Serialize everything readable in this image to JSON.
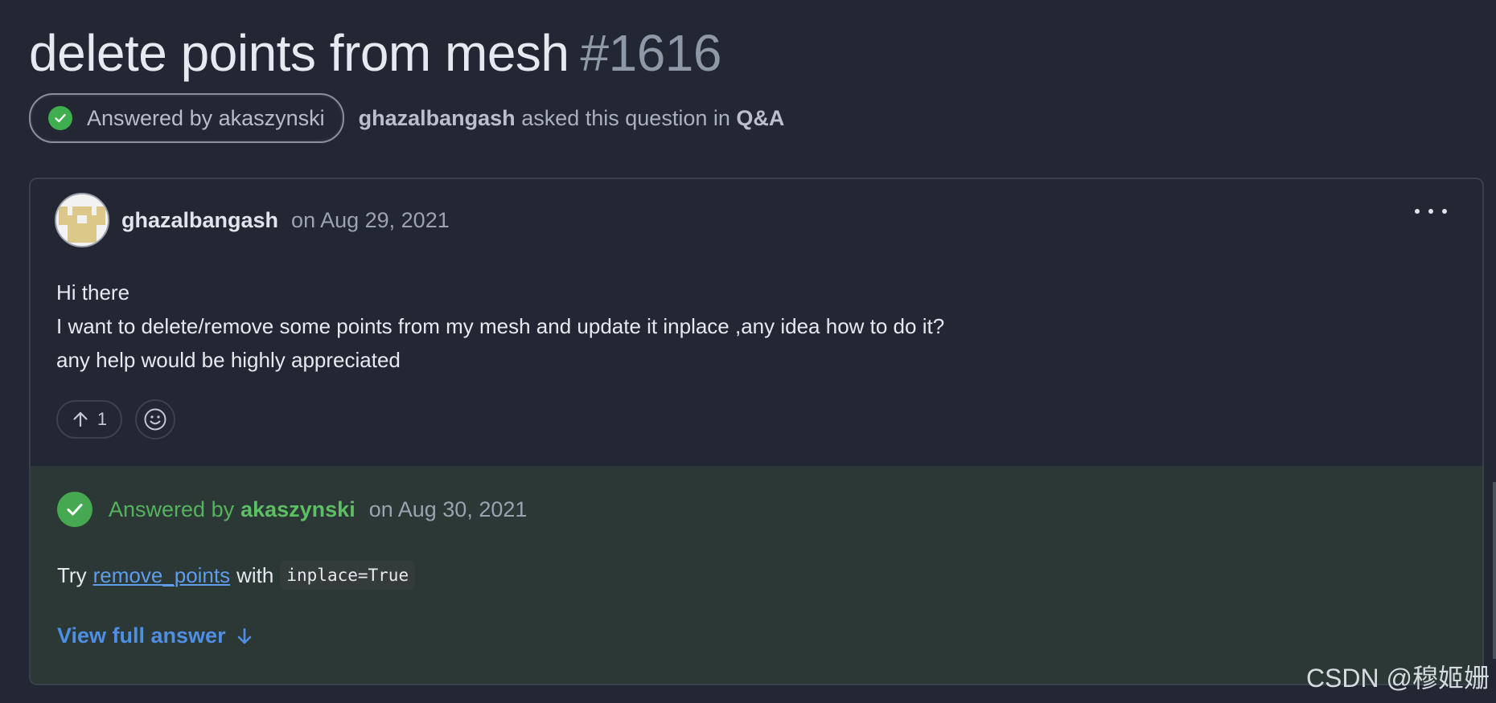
{
  "discussion": {
    "title": "delete points from mesh",
    "number": "#1616"
  },
  "meta": {
    "badge_label": "Answered by akaszynski",
    "asker": "ghazalbangash",
    "asked_text": "asked this question in",
    "category": "Q&A"
  },
  "post": {
    "author": "ghazalbangash",
    "date": "on Aug 29, 2021",
    "lines": [
      "Hi there",
      "I want to delete/remove some points from my mesh and update it inplace ,any idea how to do it?",
      "any help would be highly appreciated"
    ],
    "upvote_count": "1",
    "more_icon": "kebab-horizontal-icon",
    "avatar": "identicon"
  },
  "answer": {
    "label": "Answered by",
    "author": "akaszynski",
    "date": "on Aug 30, 2021",
    "text_before": "Try",
    "link_text": "remove_points",
    "text_middle": "with",
    "code": "inplace=True",
    "view_full": "View full answer"
  },
  "watermark": "CSDN @穆姬姗",
  "colors": {
    "background": "#222733",
    "answer_background": "#2b3836",
    "success_green": "#46a851",
    "link_blue": "#4f8fe3"
  }
}
